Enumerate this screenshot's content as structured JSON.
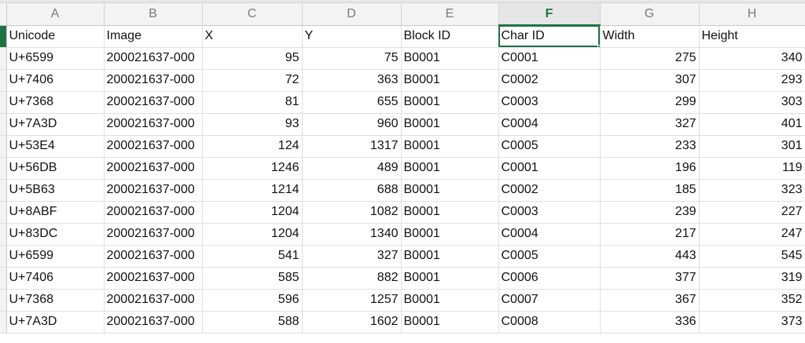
{
  "sheet": {
    "accent_color": "#1f7244",
    "selected_cell": "F1",
    "column_letters": [
      "A",
      "B",
      "C",
      "D",
      "E",
      "F",
      "G",
      "H"
    ],
    "header_row": [
      "Unicode",
      "Image",
      "X",
      "Y",
      "Block ID",
      "Char ID",
      "Width",
      "Height"
    ],
    "rows": [
      [
        "U+6599",
        "200021637-000",
        "95",
        "75",
        "B0001",
        "C0001",
        "275",
        "340"
      ],
      [
        "U+7406",
        "200021637-000",
        "72",
        "363",
        "B0001",
        "C0002",
        "307",
        "293"
      ],
      [
        "U+7368",
        "200021637-000",
        "81",
        "655",
        "B0001",
        "C0003",
        "299",
        "303"
      ],
      [
        "U+7A3D",
        "200021637-000",
        "93",
        "960",
        "B0001",
        "C0004",
        "327",
        "401"
      ],
      [
        "U+53E4",
        "200021637-000",
        "124",
        "1317",
        "B0001",
        "C0005",
        "233",
        "301"
      ],
      [
        "U+56DB",
        "200021637-000",
        "1246",
        "489",
        "B0001",
        "C0001",
        "196",
        "119"
      ],
      [
        "U+5B63",
        "200021637-000",
        "1214",
        "688",
        "B0001",
        "C0002",
        "185",
        "323"
      ],
      [
        "U+8ABF",
        "200021637-000",
        "1204",
        "1082",
        "B0001",
        "C0003",
        "239",
        "227"
      ],
      [
        "U+83DC",
        "200021637-000",
        "1204",
        "1340",
        "B0001",
        "C0004",
        "217",
        "247"
      ],
      [
        "U+6599",
        "200021637-000",
        "541",
        "327",
        "B0001",
        "C0005",
        "443",
        "545"
      ],
      [
        "U+7406",
        "200021637-000",
        "585",
        "882",
        "B0001",
        "C0006",
        "377",
        "319"
      ],
      [
        "U+7368",
        "200021637-000",
        "596",
        "1257",
        "B0001",
        "C0007",
        "367",
        "352"
      ],
      [
        "U+7A3D",
        "200021637-000",
        "588",
        "1602",
        "B0001",
        "C0008",
        "336",
        "373"
      ]
    ]
  }
}
